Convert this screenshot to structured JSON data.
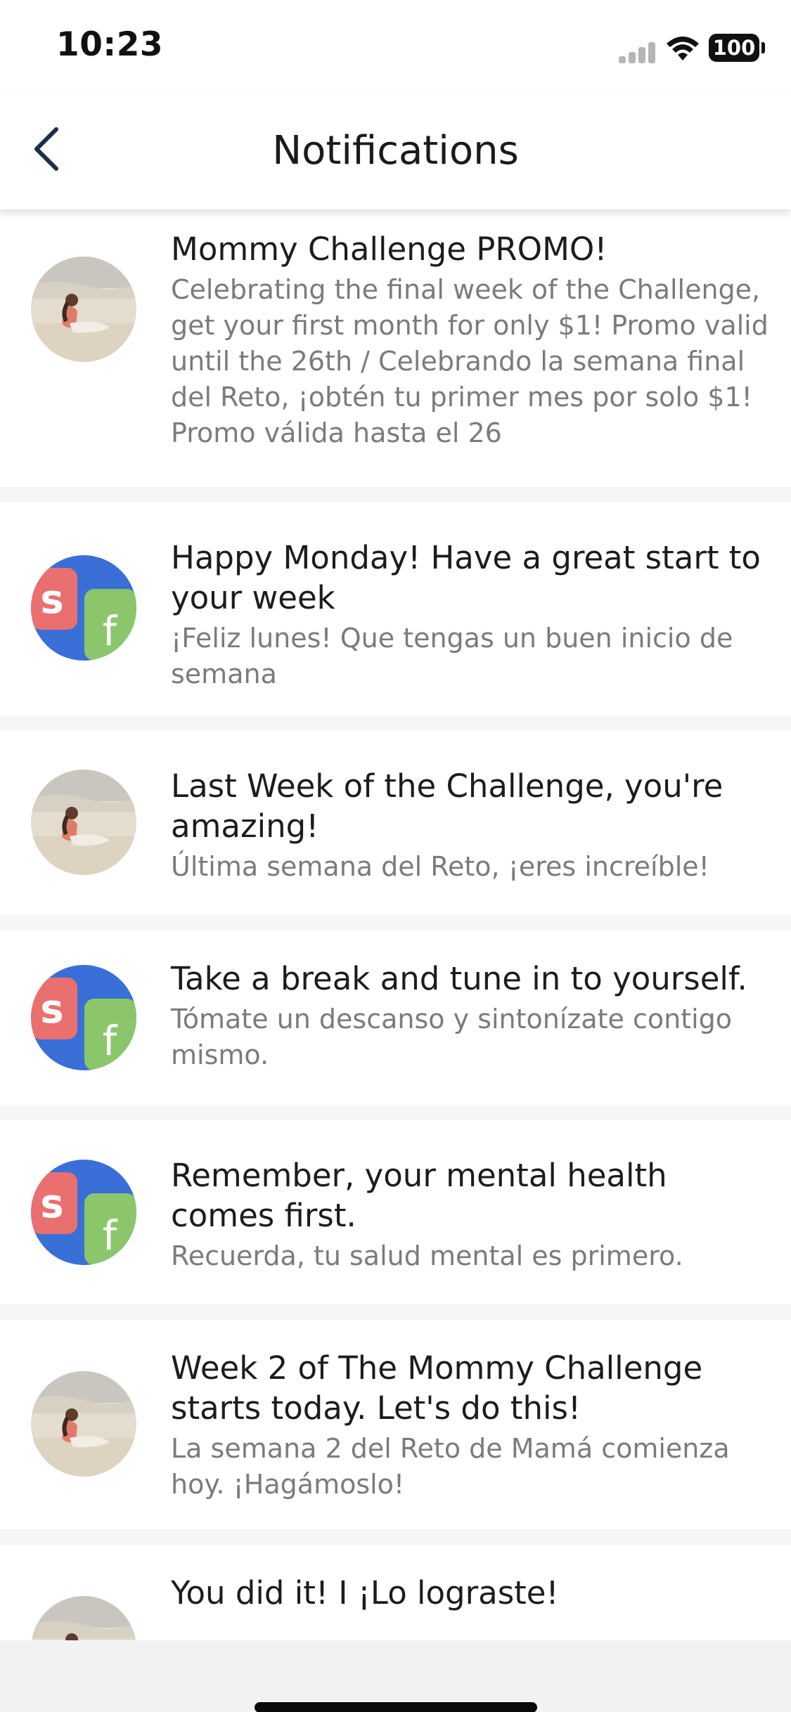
{
  "status_bar": {
    "time": "10:23",
    "battery": "100",
    "icons": [
      "signal-icon",
      "wifi-icon",
      "battery-icon"
    ]
  },
  "header": {
    "title": "Notifications",
    "back_icon": "chevron-left-icon"
  },
  "notifications": [
    {
      "avatar": "beach-photo",
      "title": "Mommy Challenge PROMO!",
      "subtitle": "Celebrating the final week of the Challenge, get your first month for only $1! Promo valid until the 26th / Celebrando la semana final del Reto, ¡obtén tu primer mes por solo $1! Promo válida hasta el 26"
    },
    {
      "avatar": "sf-logo",
      "title": "Happy Monday! Have a great start to your week",
      "subtitle": "¡Feliz lunes! Que tengas un buen inicio de semana"
    },
    {
      "avatar": "beach-photo",
      "title": "Last Week of the Challenge, you're amazing!",
      "subtitle": "Última semana del Reto, ¡eres increíble!"
    },
    {
      "avatar": "sf-logo",
      "title": "Take a break and tune in to yourself.",
      "subtitle": "Tómate un descanso y sintonízate contigo mismo."
    },
    {
      "avatar": "sf-logo",
      "title": "Remember, your mental health comes first.",
      "subtitle": "Recuerda, tu salud mental es primero."
    },
    {
      "avatar": "beach-photo",
      "title": "Week 2 of The Mommy Challenge starts today. Let's do this!",
      "subtitle": "La semana 2 del Reto de Mamá comienza hoy. ¡Hagámoslo!"
    },
    {
      "avatar": "beach-photo",
      "title": "You did it! I ¡Lo lograste!",
      "subtitle": ""
    }
  ],
  "colors": {
    "logo_blue": "#3a6fd8",
    "logo_red": "#e9706e",
    "logo_green": "#8cc66a",
    "title_text": "#1c1c1c",
    "subtitle_text": "#7b7b7b"
  }
}
